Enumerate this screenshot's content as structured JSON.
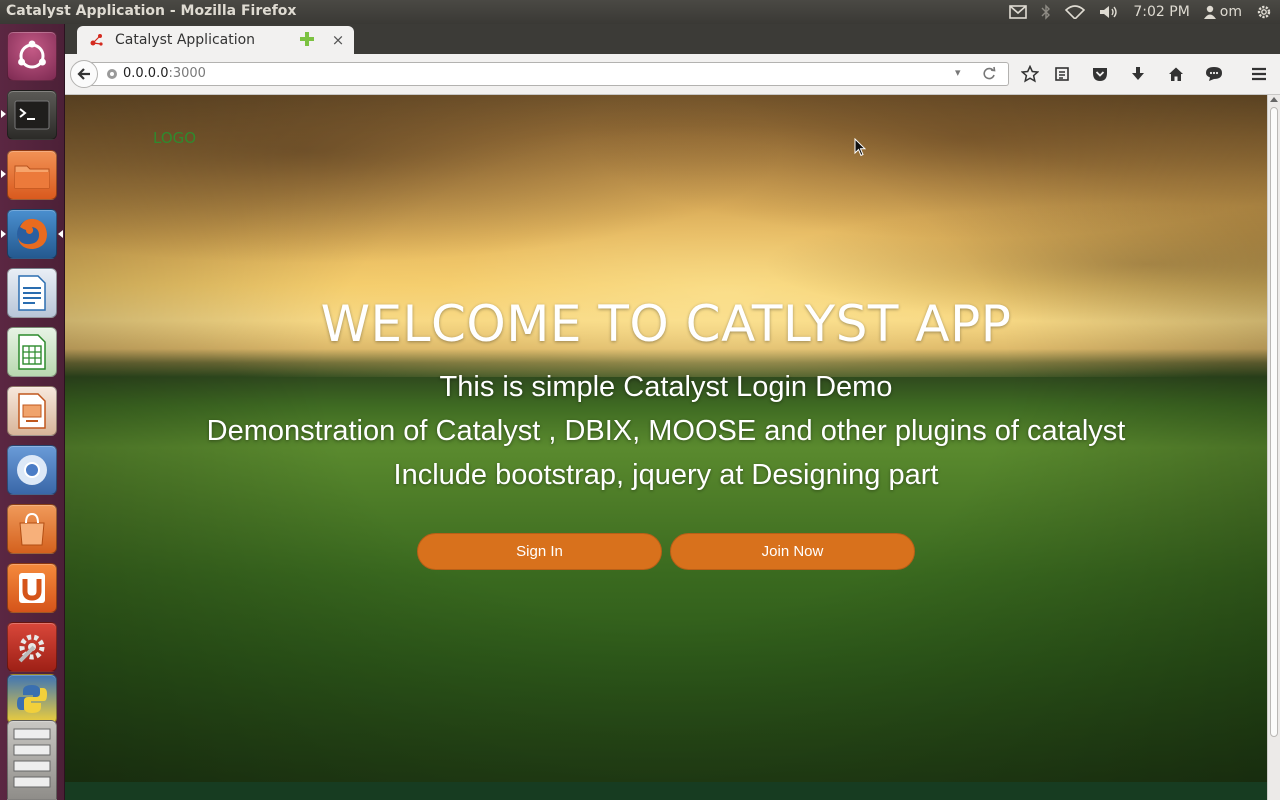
{
  "os_panel": {
    "window_title": "Catalyst Application - Mozilla Firefox",
    "clock": "7:02 PM",
    "user": "om"
  },
  "launcher": {
    "items": [
      "ubuntu-dash",
      "terminal",
      "files",
      "firefox",
      "libreoffice-writer",
      "libreoffice-calc",
      "libreoffice-impress",
      "chromium",
      "software-center",
      "ubuntu-one",
      "system-settings",
      "python",
      "workspace-switcher"
    ]
  },
  "browser": {
    "tab_title": "Catalyst Application",
    "tab_close": "×",
    "url_host": "0.0.0.0",
    "url_port": ":3000",
    "url_dropdown": "▾"
  },
  "page": {
    "logo": "LOGO",
    "headline": "WELCOME TO CATLYST APP",
    "lines": [
      "This is simple Catalyst Login Demo",
      "Demonstration of Catalyst , DBIX, MOOSE and other plugins of catalyst",
      "Include bootstrap, jquery at Designing part"
    ],
    "sign_in_label": "Sign In",
    "join_now_label": "Join Now"
  },
  "colors": {
    "button": "#d8711c",
    "logo": "#2f8a2e",
    "footer": "#173c21",
    "launcher": "#5b2742"
  }
}
